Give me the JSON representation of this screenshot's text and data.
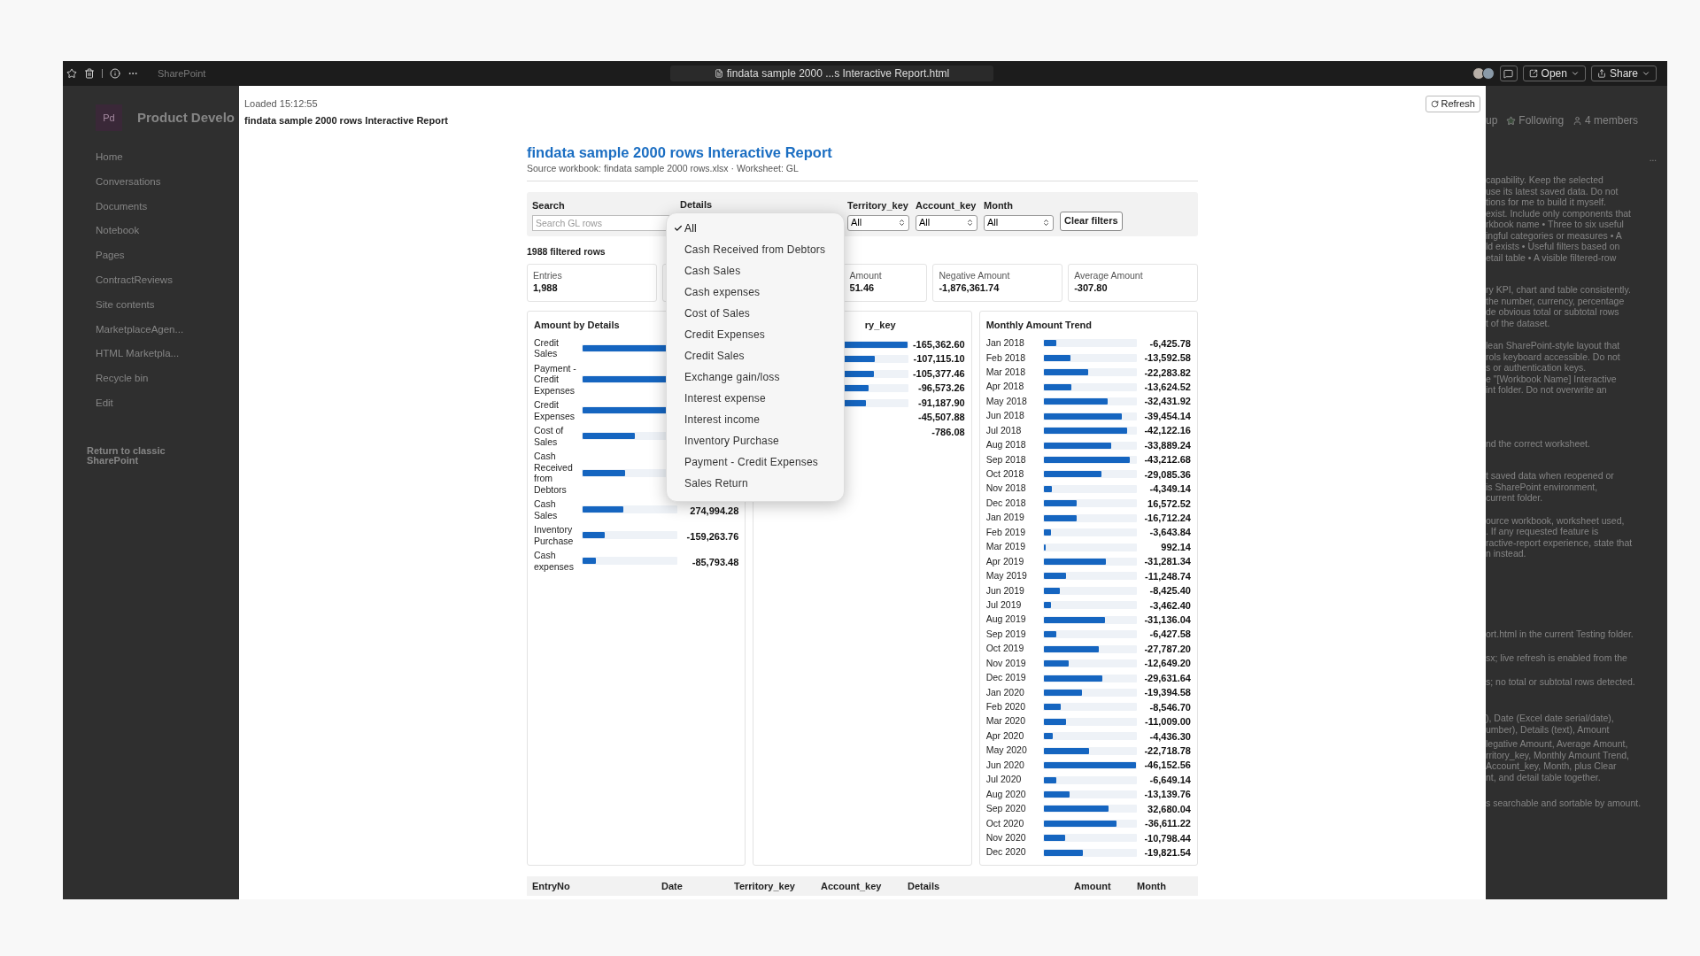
{
  "browser_bar": {
    "app_name": "SharePoint",
    "document_title": "findata sample 2000 ...s Interactive Report.html",
    "buttons": [
      "Open",
      "Share"
    ]
  },
  "sharepoint": {
    "site_logo": "Pd",
    "site_name": "Product Develo",
    "nav": [
      "Home",
      "Conversations",
      "Documents",
      "Notebook",
      "Pages",
      "ContractReviews",
      "Site contents",
      "MarketplaceAgen...",
      "HTML Marketpla...",
      "Recycle bin",
      "Edit"
    ],
    "return_link": "Return to classic SharePoint",
    "header_fragment": "up",
    "header_actions": [
      {
        "kind": "follow",
        "label": "Following"
      },
      {
        "kind": "members",
        "label": "4 members"
      }
    ],
    "more": "...",
    "text_blocks": [
      [
        "capability. Keep the selected",
        "use its latest saved data. Do not",
        "tions for me to build it myself.",
        "exist. Include only components that",
        "rkbook name • Three to six useful",
        "ingful categories or measures • A",
        "ld exists • Useful filters based on",
        "etail table • A visible filtered-row"
      ],
      [
        "ry KPI, chart and table consistently.",
        "the number, currency, percentage",
        "de obvious total or subtotal rows",
        "t of the dataset."
      ],
      [
        "lean SharePoint-style layout that",
        "rols keyboard accessible. Do not",
        "s or authentication keys.",
        "e \"[Workbook Name] Interactive",
        "int folder. Do not overwrite an"
      ],
      [
        "nd the correct worksheet."
      ],
      [
        "t saved data when reopened or",
        "is SharePoint environment,",
        "current folder."
      ],
      [
        "ource workbook, worksheet used,",
        ". If any requested feature is",
        "ractive-report experience, state that",
        "n instead."
      ],
      [
        "ort.html in the current Testing folder."
      ],
      [
        "sx; live refresh is enabled from the"
      ],
      [
        "s; no total or subtotal rows detected."
      ],
      [
        "), Date (Excel date serial/date),",
        "umber), Details (text), Amount"
      ],
      [
        "legative Amount, Average Amount,",
        "rritory_key, Monthly Amount Trend,",
        "Account_key, Month, plus Clear",
        "nt, and detail table together."
      ],
      [
        "s searchable and sortable by amount."
      ]
    ]
  },
  "viewer": {
    "loaded": "Loaded 15:12:55",
    "file_title": "findata sample 2000 rows Interactive Report",
    "refresh": "Refresh"
  },
  "report": {
    "title": "findata sample 2000 rows Interactive Report",
    "subtitle": "Source workbook: findata sample 2000 rows.xlsx · Worksheet: GL",
    "search": {
      "label": "Search",
      "placeholder": "Search GL rows"
    },
    "details_label": "Details",
    "selects": [
      {
        "label": "Territory_key",
        "value": "All"
      },
      {
        "label": "Account_key",
        "value": "All"
      },
      {
        "label": "Month",
        "value": "All"
      }
    ],
    "clear_button": "Clear filters",
    "details_menu": [
      {
        "label": "All",
        "selected": true
      },
      {
        "label": "Cash Received from Debtors",
        "selected": false
      },
      {
        "label": "Cash Sales",
        "selected": false
      },
      {
        "label": "Cash expenses",
        "selected": false
      },
      {
        "label": "Cost of Sales",
        "selected": false
      },
      {
        "label": "Credit Expenses",
        "selected": false
      },
      {
        "label": "Credit Sales",
        "selected": false
      },
      {
        "label": "Exchange gain/loss",
        "selected": false
      },
      {
        "label": "Interest expense",
        "selected": false
      },
      {
        "label": "Interest income",
        "selected": false
      },
      {
        "label": "Inventory Purchase",
        "selected": false
      },
      {
        "label": "Payment - Credit Expenses",
        "selected": false
      },
      {
        "label": "Sales Return",
        "selected": false
      }
    ],
    "row_count": "1988 filtered rows",
    "kpis": [
      {
        "kind": "metric",
        "label": "Entries",
        "value": "1,988"
      },
      {
        "kind": "covered"
      },
      {
        "kind": "partly_covered",
        "label": "Amount",
        "value": "51.46"
      },
      {
        "kind": "metric",
        "label": "Negative Amount",
        "value": "-1,876,361.74"
      },
      {
        "kind": "metric",
        "label": "Average Amount",
        "value": "-307.80"
      }
    ],
    "details_chart": {
      "title": "Amount by Details",
      "rows": [
        {
          "label": "Credit Sales",
          "level": 0.95
        },
        {
          "label": "Payment - Credit Expenses",
          "level": 0.92
        },
        {
          "label": "Credit Expenses",
          "level": 0.9
        },
        {
          "label": "Cost of Sales",
          "level": 0.56
        },
        {
          "label": "Cash Received from Debtors",
          "level": 0.45
        },
        {
          "label": "Cash Sales",
          "level": 0.43,
          "value": "274,994.28"
        },
        {
          "label": "Inventory Purchase",
          "level": 0.24,
          "value": "-159,263.76"
        },
        {
          "label": "Cash expenses",
          "level": 0.14,
          "value": "-85,793.48"
        }
      ]
    },
    "territory_chart": {
      "title": "ry_key",
      "rows": [
        {
          "level": 1.0,
          "value": "-165,362.60"
        },
        {
          "level": 0.65,
          "value": "-107,115.10"
        },
        {
          "level": 0.64,
          "value": "-105,377.46"
        },
        {
          "level": 0.58,
          "value": "-96,573.26"
        },
        {
          "level": 0.55,
          "value": "-91,187.90"
        },
        {
          "value": "-45,507.88"
        },
        {
          "value": "-786.08"
        }
      ]
    },
    "trend_chart": {
      "title": "Monthly Amount Trend",
      "rows": [
        {
          "label": "Jan 2018",
          "level": 0.14,
          "value": "-6,425.78"
        },
        {
          "label": "Feb 2018",
          "level": 0.29,
          "value": "-13,592.58"
        },
        {
          "label": "Mar 2018",
          "level": 0.48,
          "value": "-22,283.82"
        },
        {
          "label": "Apr 2018",
          "level": 0.3,
          "value": "-13,624.52"
        },
        {
          "label": "May 2018",
          "level": 0.7,
          "value": "-32,431.92"
        },
        {
          "label": "Jun 2018",
          "level": 0.85,
          "value": "-39,454.14"
        },
        {
          "label": "Jul 2018",
          "level": 0.91,
          "value": "-42,122.16"
        },
        {
          "label": "Aug 2018",
          "level": 0.73,
          "value": "-33,889.24"
        },
        {
          "label": "Sep 2018",
          "level": 0.94,
          "value": "-43,212.68"
        },
        {
          "label": "Oct 2018",
          "level": 0.63,
          "value": "-29,085.36"
        },
        {
          "label": "Nov 2018",
          "level": 0.09,
          "value": "-4,349.14"
        },
        {
          "label": "Dec 2018",
          "level": 0.36,
          "value": "16,572.52"
        },
        {
          "label": "Jan 2019",
          "level": 0.36,
          "value": "-16,712.24"
        },
        {
          "label": "Feb 2019",
          "level": 0.08,
          "value": "-3,643.84"
        },
        {
          "label": "Mar 2019",
          "level": 0.02,
          "value": "992.14"
        },
        {
          "label": "Apr 2019",
          "level": 0.68,
          "value": "-31,281.34"
        },
        {
          "label": "May 2019",
          "level": 0.24,
          "value": "-11,248.74"
        },
        {
          "label": "Jun 2019",
          "level": 0.18,
          "value": "-8,425.40"
        },
        {
          "label": "Jul 2019",
          "level": 0.08,
          "value": "-3,462.40"
        },
        {
          "label": "Aug 2019",
          "level": 0.67,
          "value": "-31,136.04"
        },
        {
          "label": "Sep 2019",
          "level": 0.14,
          "value": "-6,427.58"
        },
        {
          "label": "Oct 2019",
          "level": 0.6,
          "value": "-27,787.20"
        },
        {
          "label": "Nov 2019",
          "level": 0.27,
          "value": "-12,649.20"
        },
        {
          "label": "Dec 2019",
          "level": 0.64,
          "value": "-29,631.64"
        },
        {
          "label": "Jan 2020",
          "level": 0.42,
          "value": "-19,394.58"
        },
        {
          "label": "Feb 2020",
          "level": 0.19,
          "value": "-8,546.70"
        },
        {
          "label": "Mar 2020",
          "level": 0.24,
          "value": "-11,009.00"
        },
        {
          "label": "Apr 2020",
          "level": 0.1,
          "value": "-4,436.30"
        },
        {
          "label": "May 2020",
          "level": 0.49,
          "value": "-22,718.78"
        },
        {
          "label": "Jun 2020",
          "level": 1.0,
          "value": "-46,152.56"
        },
        {
          "label": "Jul 2020",
          "level": 0.14,
          "value": "-6,649.14"
        },
        {
          "label": "Aug 2020",
          "level": 0.28,
          "value": "-13,139.76"
        },
        {
          "label": "Sep 2020",
          "level": 0.71,
          "value": "32,680.04"
        },
        {
          "label": "Oct 2020",
          "level": 0.79,
          "value": "-36,611.22"
        },
        {
          "label": "Nov 2020",
          "level": 0.23,
          "value": "-10,798.44"
        },
        {
          "label": "Dec 2020",
          "level": 0.43,
          "value": "-19,821.54"
        }
      ]
    },
    "table": {
      "columns": [
        "EntryNo",
        "Date",
        "Territory_key",
        "Account_key",
        "Details",
        "Amount",
        "Month"
      ]
    }
  }
}
